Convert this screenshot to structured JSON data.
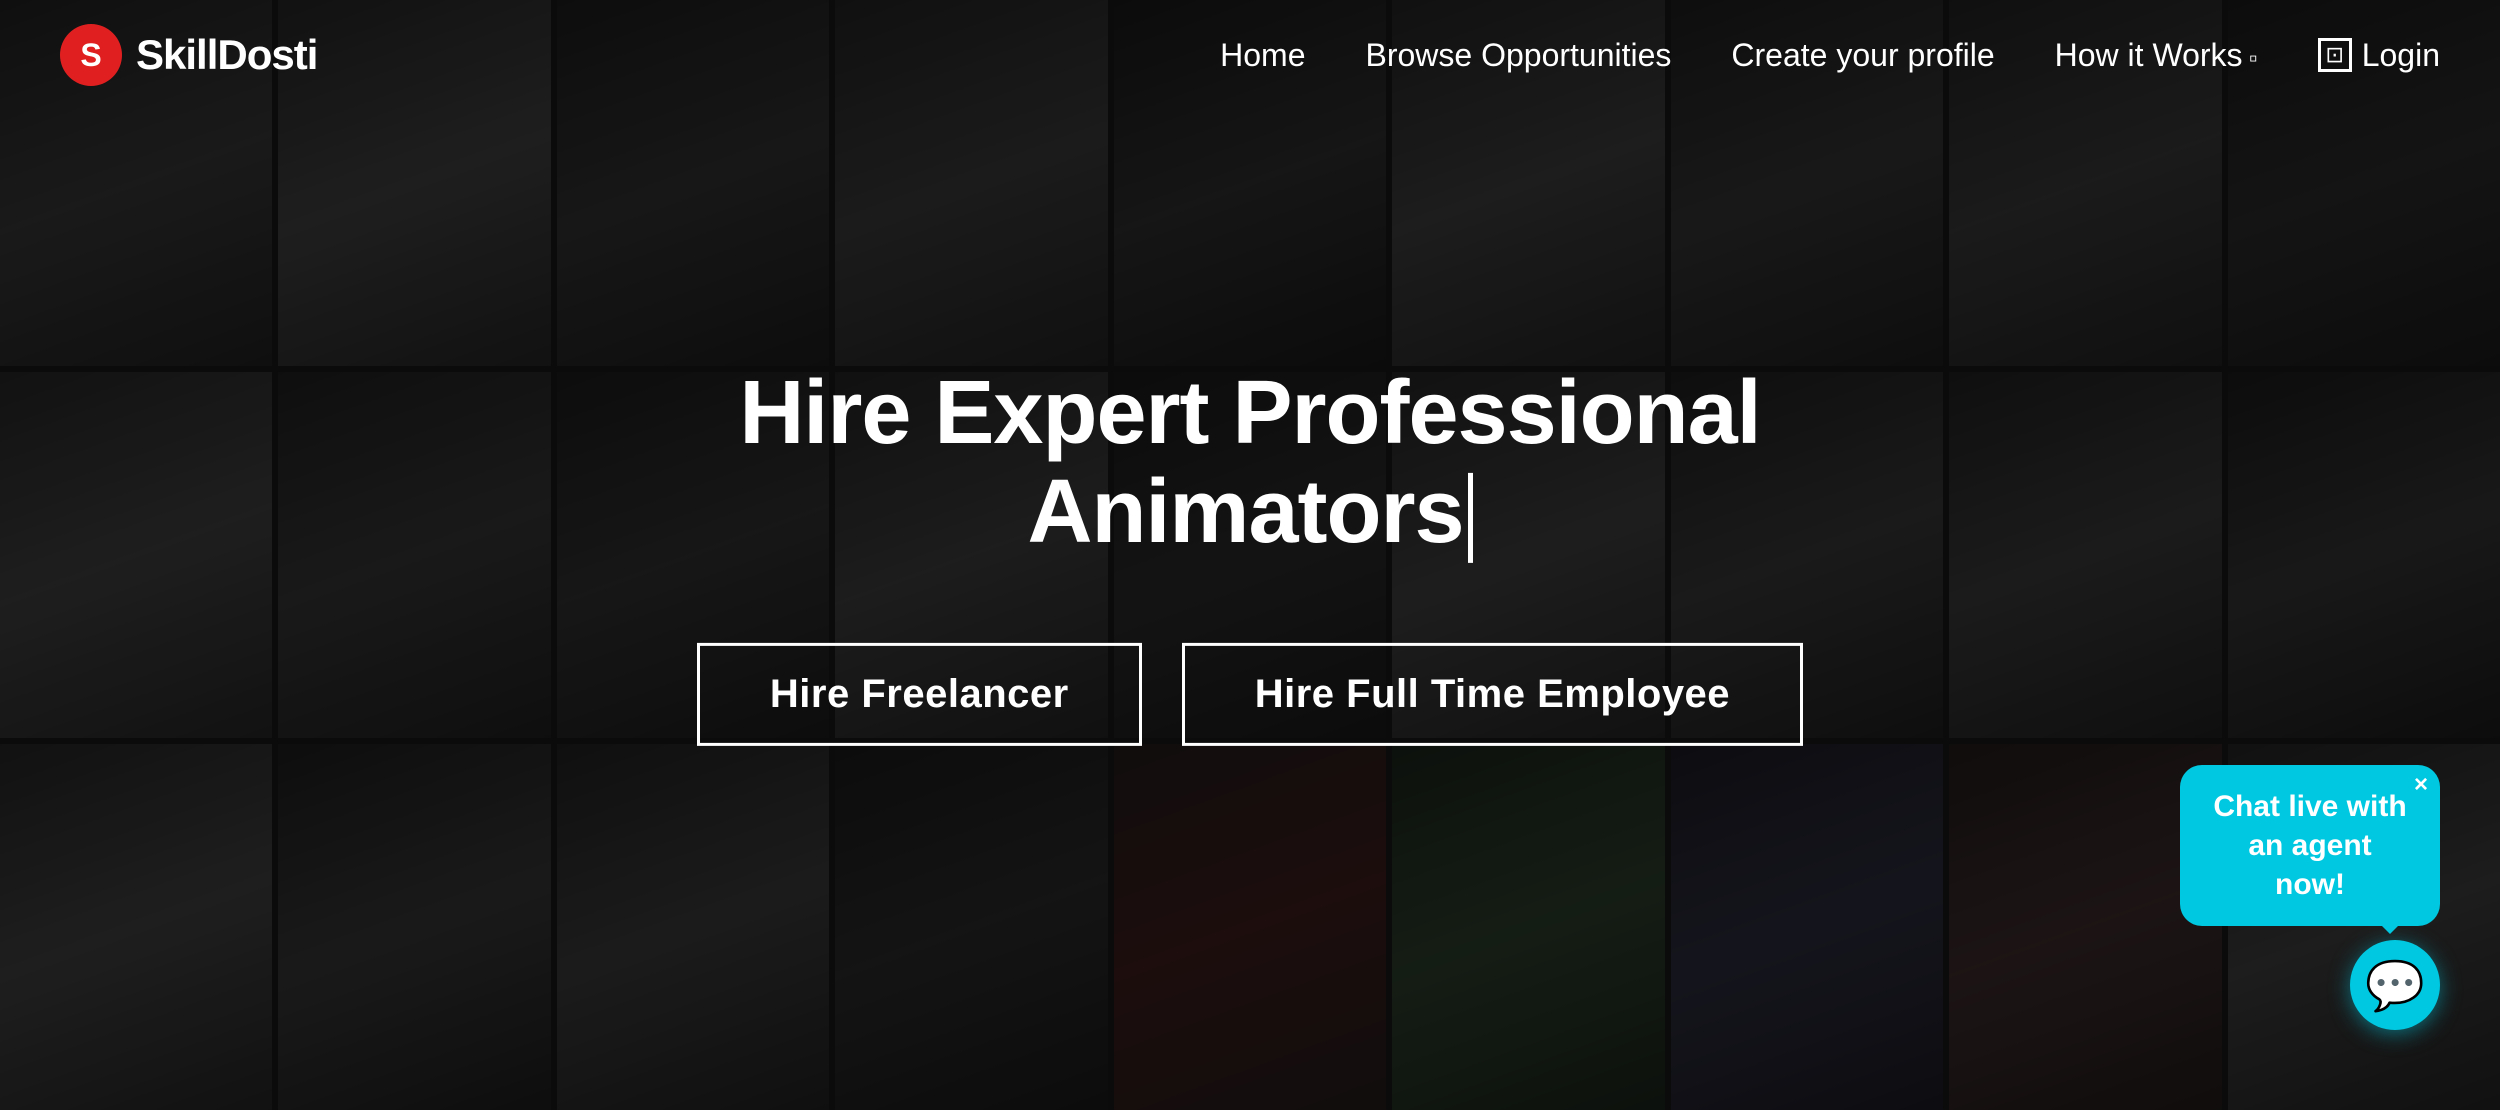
{
  "brand": {
    "icon": "S",
    "name": "SkillDosti"
  },
  "navbar": {
    "home_label": "Home",
    "browse_label": "Browse Opportunities",
    "profile_label": "Create your profile",
    "how_label": "How it Works",
    "login_label": "Login"
  },
  "hero": {
    "title": "Hire Expert Professional Animators",
    "cursor_char": "|",
    "btn_freelancer": "Hire Freelancer",
    "btn_fulltime": "Hire Full Time Employee"
  },
  "chat": {
    "bubble_text": "Chat live with an agent now!",
    "close_char": "×"
  },
  "bg_cells_count": 27
}
